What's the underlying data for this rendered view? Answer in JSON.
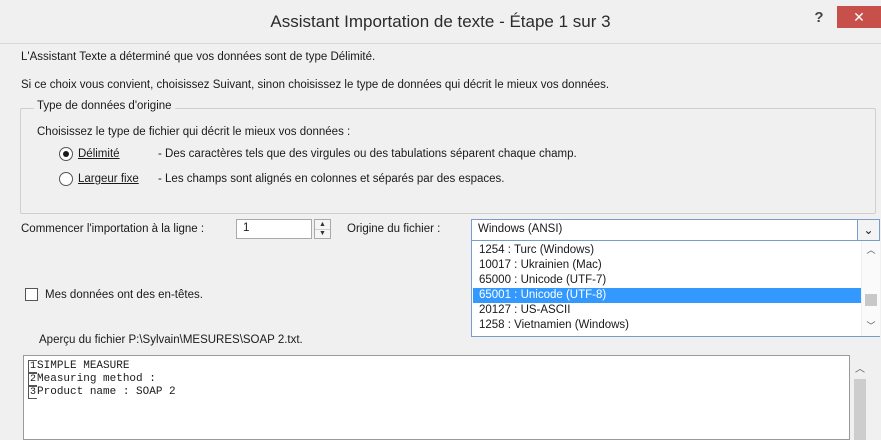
{
  "window": {
    "title": "Assistant Importation de texte - Étape 1 sur 3",
    "help_label": "?",
    "close_label": "✕"
  },
  "intro": {
    "line1": "L'Assistant Texte a déterminé que vos données sont de type Délimité.",
    "line2": "Si ce choix vous convient, choisissez Suivant, sinon choisissez le type de données qui décrit le mieux vos données."
  },
  "data_type": {
    "legend": "Type de données d'origine",
    "prompt": "Choisissez le type de fichier qui décrit le mieux vos données :",
    "options": [
      {
        "label": "Délimité",
        "description": "- Des caractères tels que des virgules ou des tabulations séparent chaque champ.",
        "checked": true
      },
      {
        "label": "Largeur fixe",
        "description": "- Les champs sont alignés en colonnes et séparés par des espaces.",
        "checked": false
      }
    ]
  },
  "start_row": {
    "label": "Commencer l'importation à la ligne :",
    "value": "1"
  },
  "file_origin": {
    "label": "Origine du fichier :",
    "value": "Windows (ANSI)",
    "options": [
      {
        "label": "1254 : Turc (Windows)",
        "selected": false
      },
      {
        "label": "10017 : Ukrainien (Mac)",
        "selected": false
      },
      {
        "label": "65000 : Unicode (UTF-7)",
        "selected": false
      },
      {
        "label": "65001 : Unicode (UTF-8)",
        "selected": true
      },
      {
        "label": "20127 : US-ASCII",
        "selected": false
      },
      {
        "label": "1258 : Vietnamien (Windows)",
        "selected": false
      }
    ]
  },
  "headers_checkbox": {
    "label": "Mes données ont des en-têtes.",
    "checked": false
  },
  "preview": {
    "label": "Aperçu du fichier P:\\Sylvain\\MESURES\\SOAP 2.txt.",
    "lines": [
      {
        "num": "1",
        "text": "SIMPLE MEASURE"
      },
      {
        "num": "2",
        "text": "Measuring method :"
      },
      {
        "num": "3",
        "text": "Product name : SOAP 2"
      }
    ]
  },
  "colors": {
    "close_button": "#c7504a",
    "selection": "#3399ff",
    "focus_border": "#7a9ccc"
  }
}
